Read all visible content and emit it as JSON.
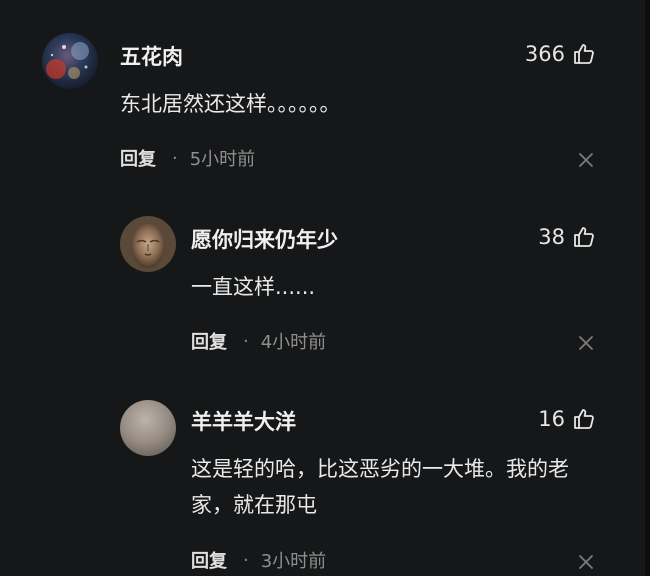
{
  "comments": [
    {
      "username": "五花肉",
      "likes": "366",
      "content": "东北居然还这样。。。。。。",
      "reply_label": "回复",
      "separator": "·",
      "time": "5小时前",
      "avatar_icon": "starry-avatar-icon"
    },
    {
      "username": "愿你归来仍年少",
      "likes": "38",
      "content": "一直这样......",
      "reply_label": "回复",
      "separator": "·",
      "time": "4小时前",
      "avatar_icon": "buddha-avatar-icon"
    },
    {
      "username": "羊羊羊大洋",
      "likes": "16",
      "content": "这是轻的哈，比这恶劣的一大堆。我的老家，就在那屯",
      "reply_label": "回复",
      "separator": "·",
      "time": "3小时前",
      "avatar_icon": "plain-avatar-icon"
    }
  ],
  "colors": {
    "background": "#161718",
    "text_primary": "#e9e9e9",
    "text_secondary": "#8f8f8f"
  }
}
